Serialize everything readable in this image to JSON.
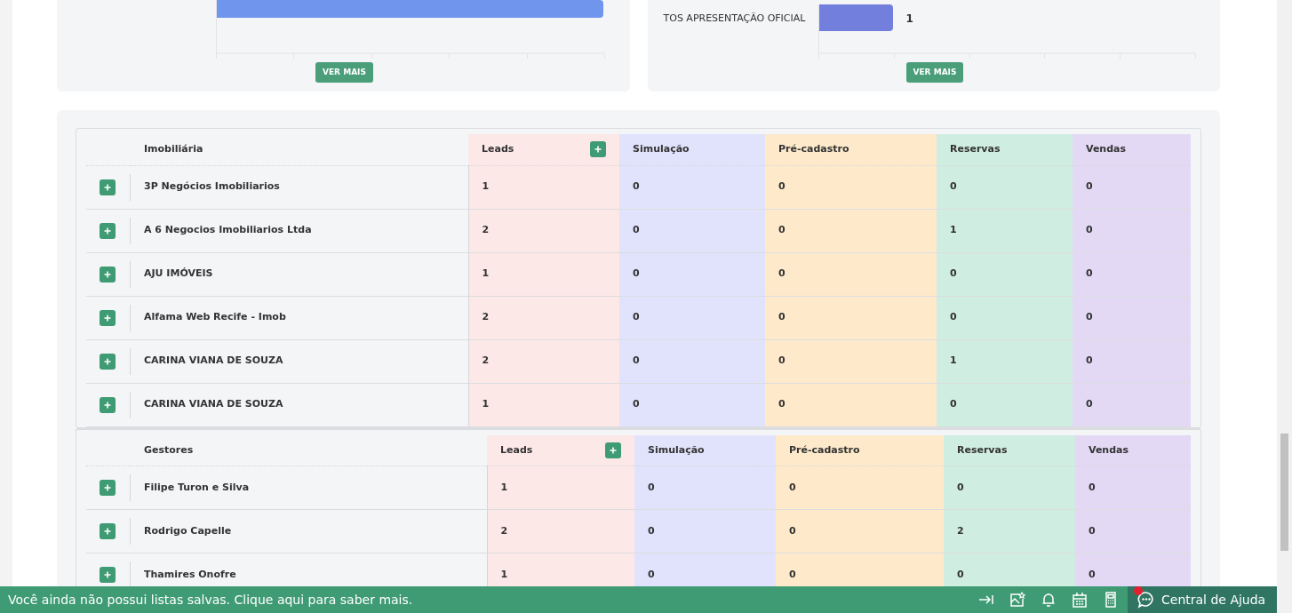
{
  "charts": [
    {
      "button": "VER MAIS"
    },
    {
      "bar_label": "TOS APRESENTAÇÃO OFICIAL",
      "value_label": "1",
      "button": "VER MAIS"
    }
  ],
  "tables": [
    {
      "columns": [
        "Imobiliária",
        "Leads",
        "Simulação",
        "Pré-cadastro",
        "Reservas",
        "Vendas"
      ],
      "rows": [
        [
          "3P Negócios Imobiliarios",
          "1",
          "0",
          "0",
          "0",
          "0"
        ],
        [
          "A 6 Negocios Imobiliarios Ltda",
          "2",
          "0",
          "0",
          "1",
          "0"
        ],
        [
          "AJU IMÓVEIS",
          "1",
          "0",
          "0",
          "0",
          "0"
        ],
        [
          "Alfama Web Recife - Imob",
          "2",
          "0",
          "0",
          "0",
          "0"
        ],
        [
          "CARINA VIANA DE SOUZA",
          "2",
          "0",
          "0",
          "1",
          "0"
        ],
        [
          "CARINA VIANA DE SOUZA",
          "1",
          "0",
          "0",
          "0",
          "0"
        ]
      ]
    },
    {
      "columns": [
        "Gestores",
        "Leads",
        "Simulação",
        "Pré-cadastro",
        "Reservas",
        "Vendas"
      ],
      "rows": [
        [
          "Filipe Turon e Silva",
          "1",
          "0",
          "0",
          "0",
          "0"
        ],
        [
          "Rodrigo Capelle",
          "2",
          "0",
          "0",
          "2",
          "0"
        ],
        [
          "Thamires Onofre",
          "1",
          "0",
          "0",
          "0",
          "0"
        ]
      ]
    }
  ],
  "footer": {
    "message": "Você ainda não possui listas salvas. Clique aqui para saber mais.",
    "help": "Central de Ajuda",
    "notification": true
  }
}
